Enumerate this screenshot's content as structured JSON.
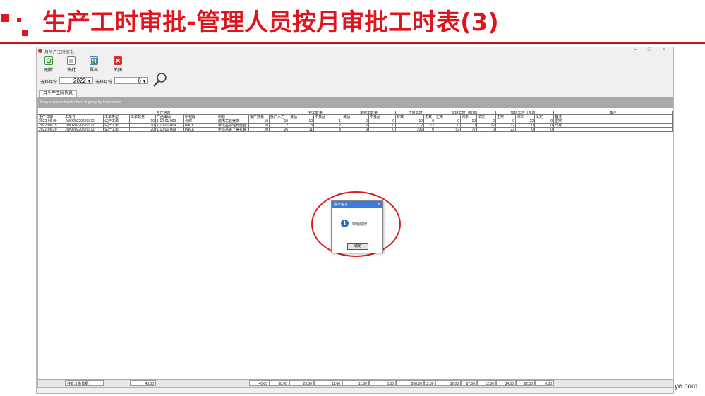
{
  "slide": {
    "title": "生产工时审批-管理人员按月审批工时表(3)",
    "accent": "#e0141e",
    "watermark": "ye.com"
  },
  "window": {
    "title": "月生产工时审批",
    "controls": [
      "–",
      "□",
      "×"
    ]
  },
  "toolbar": {
    "buttons": [
      {
        "label": "刷新",
        "icon": "refresh-icon"
      },
      {
        "label": "审批",
        "icon": "approve-icon"
      },
      {
        "label": "导出",
        "icon": "export-icon"
      },
      {
        "label": "关闭",
        "icon": "close-icon"
      }
    ],
    "year_label": "选择年份",
    "year_value": "2022",
    "month_label": "选择月份",
    "month_value": "6",
    "search_icon": "magnifier-icon"
  },
  "tab": {
    "label": "月生产工时信息"
  },
  "grid": {
    "group_hint": "Drag a column header here to group by that column",
    "group_headers": [
      "生产信息",
      "完工数量",
      "未完工数量",
      "正常工时",
      "加班工时（有效）",
      "加班工时（无效）",
      "备注"
    ],
    "columns": [
      "生产日期",
      "工单号",
      "工单类型",
      "工单数量",
      "产品编码",
      "制程段",
      "制程",
      "投产数量",
      "投产人力",
      "良品",
      "不良品",
      "良品",
      "不良品",
      "有效",
      "无效",
      "正常",
      "周末",
      "法定",
      "正常",
      "周末",
      "法定",
      "备注"
    ],
    "rows": [
      [
        "2022-06-09",
        "JWO20220620372",
        "试产工单",
        "10",
        "1-10-01-009",
        "点焊",
        "腊电芯装壳架",
        "10",
        "10",
        "10",
        "1",
        "0",
        "0",
        "10",
        "0",
        "0",
        "10",
        "0",
        "0",
        "22",
        "0",
        "正常"
      ],
      [
        "2022-06-15",
        "JWO20220620372",
        "试产工单",
        "10",
        "1-10-01-009",
        "PACK",
        "半成品清理粉检查",
        "10",
        "2",
        "8",
        "2",
        "2",
        "0",
        "2",
        "12",
        "0",
        "0",
        "12",
        "12",
        "0",
        "0",
        "异常"
      ],
      [
        "2022-06-20",
        "JWO20220620372",
        "试产工单",
        "20",
        "1-10-01-009",
        "PACK",
        "半成品装上盖打螺",
        "20",
        "26",
        "11",
        "8",
        "9",
        "0",
        "196",
        "0",
        "52",
        "77",
        "0",
        "22",
        "0",
        "0",
        ""
      ]
    ],
    "footer": {
      "count": "共有:3 条数据",
      "totals": [
        "40.00",
        "40.00",
        "38.00",
        "29.00",
        "11.00",
        "11.00",
        "0.00",
        "208.00",
        "12.00",
        "52.00",
        "87.00",
        "12.00",
        "34.00",
        "22.00",
        "0.00"
      ]
    }
  },
  "dialog": {
    "title": "提示信息",
    "message": "审批成功!",
    "ok": "确定",
    "close": "×",
    "highlight_color": "#d81e1e"
  }
}
